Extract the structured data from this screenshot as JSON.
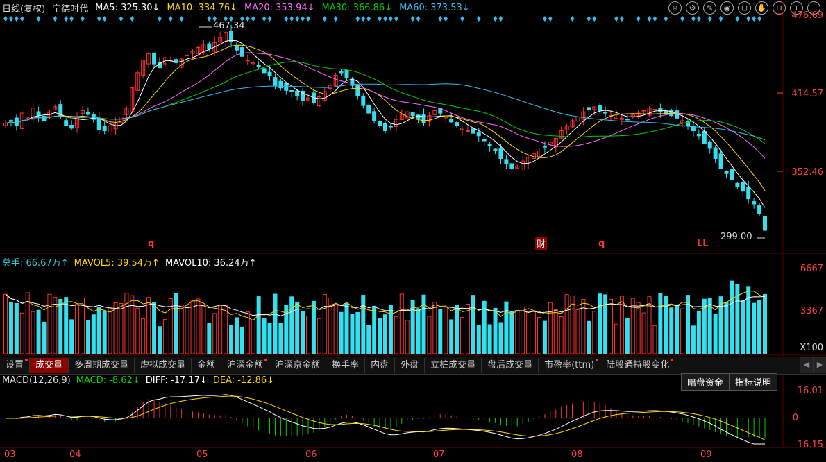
{
  "title_legend": [
    {
      "text": "日线(复权)",
      "color": "#dddddd"
    },
    {
      "text": "宁德时代",
      "color": "#dddddd"
    },
    {
      "text": "MA5: 325.30↓",
      "color": "#ffffff"
    },
    {
      "text": "MA10: 334.76↓",
      "color": "#ffd700"
    },
    {
      "text": "MA20: 353.94↓",
      "color": "#ff66ff"
    },
    {
      "text": "MA30: 366.86↓",
      "color": "#00d000"
    },
    {
      "text": "MA60: 373.53↓",
      "color": "#33bbee"
    }
  ],
  "toolbar_icons": [
    "settings-icon",
    "gear-icon",
    "brush-icon",
    "eye-icon",
    "box-icon",
    "hand-icon",
    "lock-icon",
    "zoom-in-icon",
    "zoom-out-icon"
  ],
  "toolbar_glyphs": [
    "⊛",
    "⚙",
    "✎",
    "◉",
    "⊟",
    "✋",
    "⊓",
    "+",
    "−"
  ],
  "price_axis": [
    "476.69",
    "414.57",
    "352.46"
  ],
  "high_marker": "467.34",
  "low_marker": "299.00",
  "markers": [
    "q",
    "财",
    "q",
    "LL"
  ],
  "volume_legend": [
    {
      "text": "总手: 66.67万↑",
      "color": "#33ccdd"
    },
    {
      "text": "MAVOL5: 39.54万↑",
      "color": "#ffd700"
    },
    {
      "text": "MAVOL10: 36.24万↑",
      "color": "#ffffff"
    }
  ],
  "volume_axis": [
    "6667",
    "3367"
  ],
  "volume_unit": "X100",
  "tabs": [
    {
      "label": "设置",
      "dot": true,
      "active": false
    },
    {
      "label": "成交量",
      "dot": false,
      "active": true
    },
    {
      "label": "多周期成交量",
      "dot": false,
      "active": false
    },
    {
      "label": "虚拟成交量",
      "dot": false,
      "active": false
    },
    {
      "label": "金额",
      "dot": false,
      "active": false
    },
    {
      "label": "沪深金额",
      "dot": true,
      "active": false
    },
    {
      "label": "沪深京金额",
      "dot": false,
      "active": false
    },
    {
      "label": "换手率",
      "dot": false,
      "active": false
    },
    {
      "label": "内盘",
      "dot": false,
      "active": false
    },
    {
      "label": "外盘",
      "dot": false,
      "active": false
    },
    {
      "label": "立桩成交量",
      "dot": false,
      "active": false
    },
    {
      "label": "盘后成交量",
      "dot": false,
      "active": false
    },
    {
      "label": "市盈率(ttm)",
      "dot": true,
      "active": false
    },
    {
      "label": "陆股通持股变化",
      "dot": true,
      "active": false
    }
  ],
  "macd_legend": [
    {
      "text": "MACD(12,26,9)",
      "color": "#dddddd"
    },
    {
      "text": "MACD: -8.62↓",
      "color": "#00d000"
    },
    {
      "text": "DIFF: -17.17↓",
      "color": "#ffffff"
    },
    {
      "text": "DEA: -12.86↓",
      "color": "#ffd700"
    }
  ],
  "macd_buttons": [
    "暗盘资金",
    "指标说明"
  ],
  "macd_axis": [
    "16.01",
    "0",
    "-16.15"
  ],
  "dates": [
    "03",
    "04",
    "05",
    "06",
    "07",
    "08",
    "09"
  ],
  "colors": {
    "up": "#ff3030",
    "down": "#33e0f0",
    "ma5": "#ffffff",
    "ma10": "#ffd700",
    "ma20": "#ff66ff",
    "ma30": "#00d000",
    "ma60": "#33bbee",
    "axis": "#ff4040",
    "grid": "#5a0000"
  },
  "chart_data": {
    "type": "candlestick",
    "price_ylim": [
      299.0,
      476.69
    ],
    "notes": "Approximate daily candles for 宁德时代 from Mar to mid-Sep",
    "closes": [
      390,
      392,
      388,
      398,
      395,
      402,
      396,
      392,
      399,
      403,
      395,
      388,
      386,
      395,
      400,
      397,
      393,
      385,
      384,
      388,
      390,
      395,
      402,
      418,
      430,
      440,
      445,
      437,
      434,
      442,
      440,
      438,
      441,
      444,
      447,
      450,
      452,
      449,
      454,
      458,
      462,
      455,
      448,
      443,
      440,
      438,
      435,
      430,
      428,
      420,
      418,
      416,
      415,
      412,
      408,
      410,
      406,
      411,
      415,
      420,
      428,
      430,
      426,
      420,
      412,
      404,
      398,
      392,
      388,
      384,
      387,
      393,
      397,
      399,
      396,
      394,
      390,
      396,
      400,
      398,
      395,
      391,
      388,
      386,
      384,
      382,
      380,
      376,
      372,
      368,
      362,
      358,
      354,
      356,
      360,
      363,
      366,
      368,
      371,
      375,
      378,
      384,
      388,
      392,
      395,
      399,
      401,
      403,
      400,
      398,
      396,
      395,
      394,
      393,
      397,
      398,
      400,
      402,
      401,
      399,
      398,
      396,
      394,
      392,
      388,
      384,
      380,
      374,
      370,
      362,
      354,
      350,
      345,
      340,
      336,
      330,
      326,
      318,
      305
    ]
  }
}
